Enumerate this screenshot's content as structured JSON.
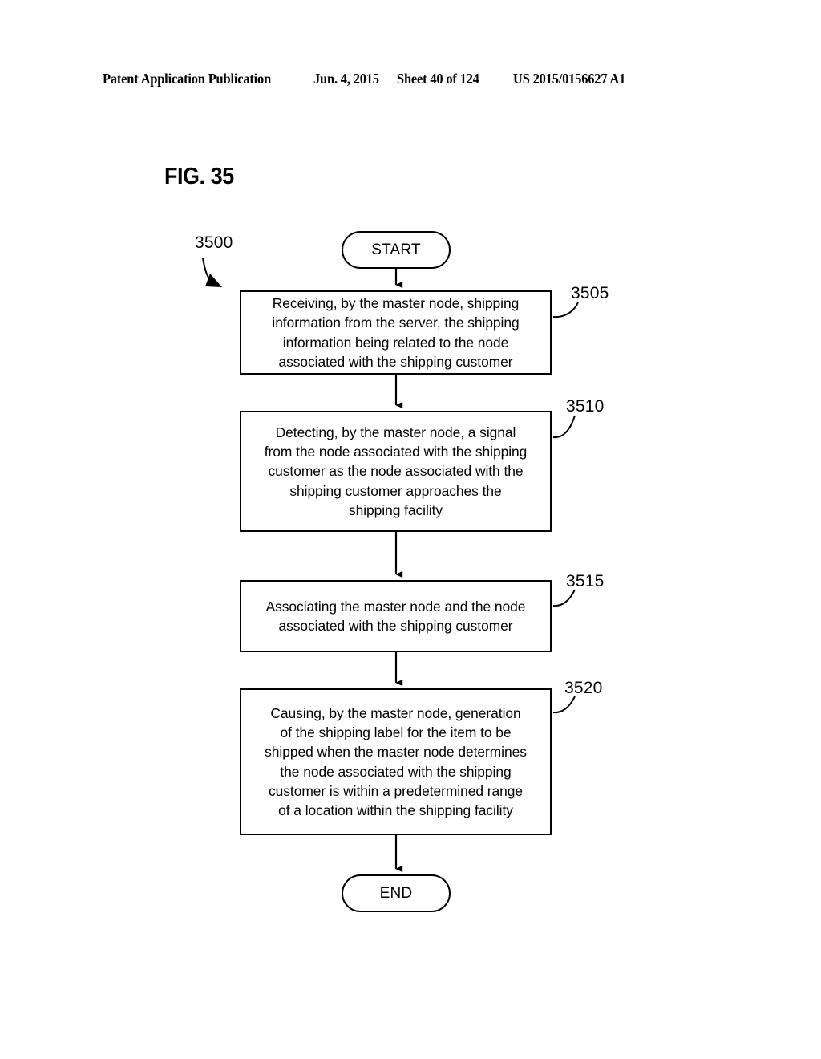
{
  "header": {
    "publication": "Patent Application Publication",
    "date": "Jun. 4, 2015",
    "sheet": "Sheet 40 of 124",
    "patent_number": "US 2015/0156627 A1"
  },
  "figure": {
    "title": "FIG. 35",
    "diagram_reference": "3500"
  },
  "flowchart": {
    "start_label": "START",
    "end_label": "END",
    "steps": [
      {
        "ref": "3505",
        "text": "Receiving, by the master node, shipping\ninformation from the server, the shipping\ninformation being related to the node\nassociated with the shipping customer"
      },
      {
        "ref": "3510",
        "text": "Detecting, by the master node, a signal\nfrom the node associated with the shipping\ncustomer as the node associated with the\nshipping customer approaches the\nshipping facility"
      },
      {
        "ref": "3515",
        "text": "Associating the master node and the node\nassociated with the shipping customer"
      },
      {
        "ref": "3520",
        "text": "Causing, by the master node, generation\nof the shipping label for the item to be\nshipped when the master node determines\nthe node associated with the shipping\ncustomer is within a predetermined range\nof a location within the shipping facility"
      }
    ]
  },
  "colors": {
    "ink": "#000000",
    "page": "#ffffff"
  }
}
